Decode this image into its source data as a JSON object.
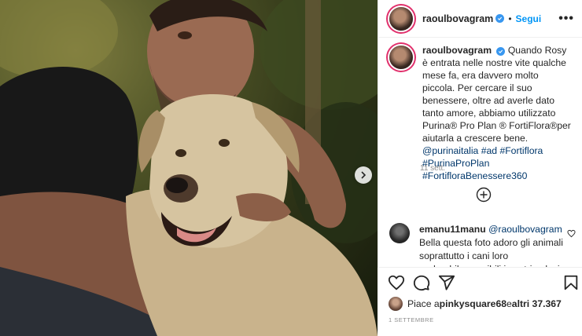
{
  "post": {
    "username": "raoulbovagram",
    "follow_label": "Segui",
    "more_label": "•••"
  },
  "caption": {
    "username": "raoulbovagram",
    "text": "Quando Rosy è entrata nelle nostre vite qualche mese fa, era davvero molto piccola. Per cercare il suo benessere, oltre ad averle dato tanto amore, abbiamo utilizzato Purina® Pro Plan ® FortiFlora®per aiutarla a crescere bene.",
    "tags": [
      "@purinaitalia",
      "#ad",
      "#Fortiflora",
      "#PurinaProPlan",
      "#FortifloraBenessere360"
    ],
    "time": "11 sett."
  },
  "comment": {
    "username": "emanu11manu",
    "mention": "@raoulbovagram",
    "text_line1": "Bella questa foto adoro gli animali",
    "text_line2": "soprattutto i cani loro",
    "text_line3": "♥adorabile sensibili  i nostri pelosi"
  },
  "likes": {
    "prefix": "Piace a ",
    "user": "pinkysquare68",
    "middle": " e ",
    "others": "altri 37.367"
  },
  "date": "1 SETTEMBRE",
  "colors": {
    "link_blue": "#0095f6",
    "tag_blue": "#00376b",
    "verified_blue": "#3897f0",
    "muted_gray": "#8e8e8e"
  },
  "icons": {
    "verified": "verified-badge-icon",
    "more": "more-options-icon",
    "next": "chevron-right-icon",
    "load_more": "plus-circle-icon",
    "like": "heart-icon",
    "comment": "comment-bubble-icon",
    "share": "paper-plane-icon",
    "save": "bookmark-icon"
  }
}
